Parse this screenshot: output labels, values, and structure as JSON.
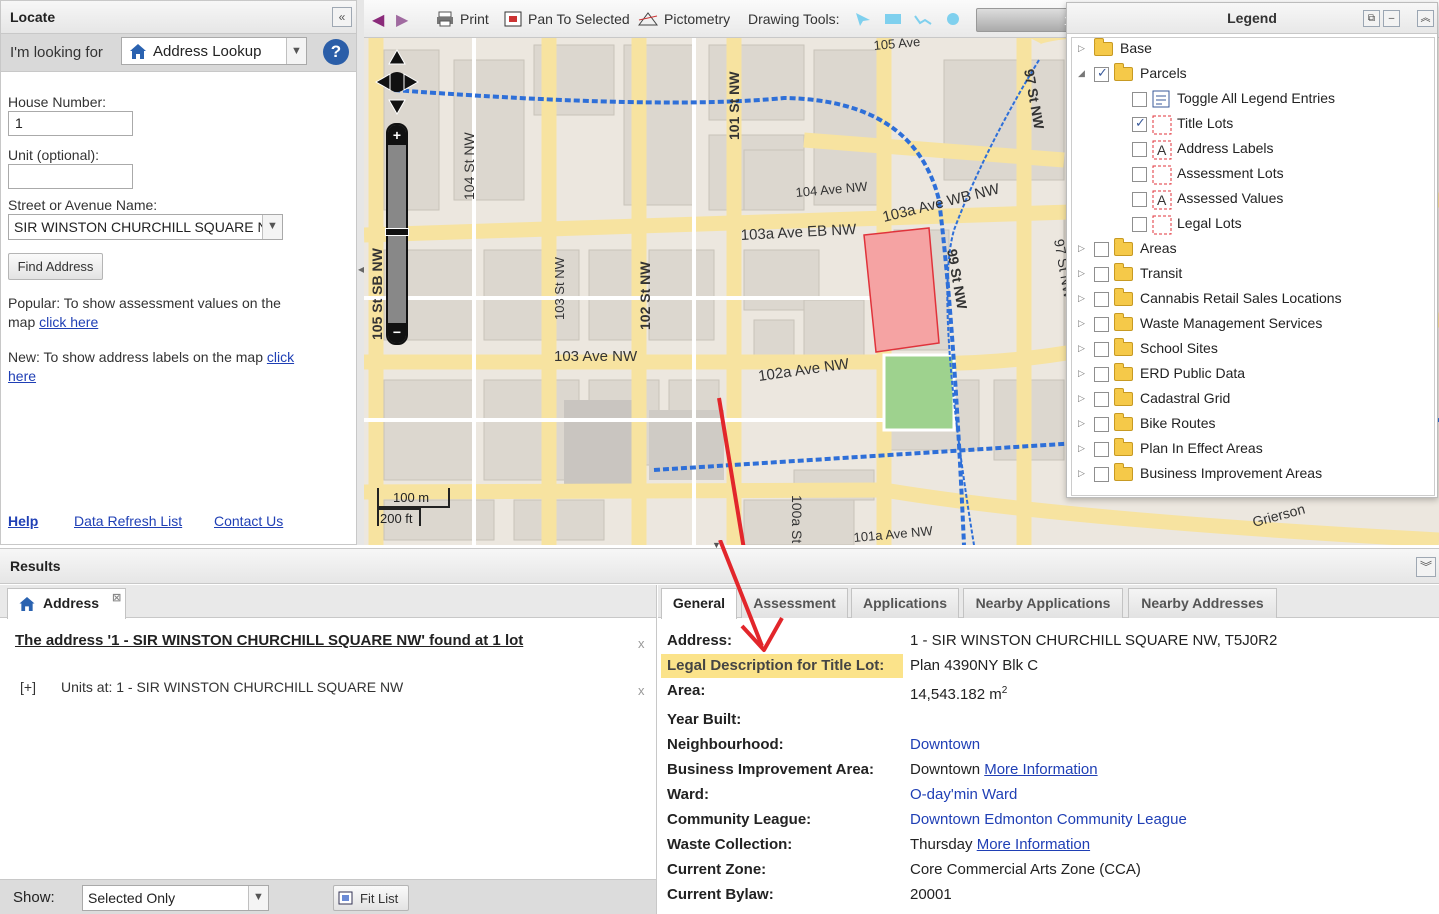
{
  "locate": {
    "title": "Locate",
    "looking_for_label": "I'm looking for",
    "looking_for_value": "Address Lookup",
    "house_number_label": "House Number:",
    "house_number_value": "1",
    "unit_label": "Unit (optional):",
    "unit_value": "",
    "street_label": "Street or Avenue Name:",
    "street_value": "SIR WINSTON CHURCHILL SQUARE N",
    "find_button": "Find Address",
    "popular_text": "Popular: To show assessment values on the map",
    "popular_link": "click here",
    "new_text": "New: To show address labels on the map",
    "new_link": "click here",
    "footer": {
      "help": "Help",
      "data_refresh": "Data Refresh List",
      "contact": "Contact Us"
    }
  },
  "toolbar": {
    "print": "Print",
    "pan_to_selected": "Pan To Selected",
    "pictometry": "Pictometry",
    "drawing_tools": "Drawing Tools:",
    "hidden_value": "1"
  },
  "map": {
    "scale_metric": "100 m",
    "scale_imperial": "200 ft",
    "streets": [
      "105 Ave",
      "97 St NW",
      "101 St NW",
      "104 St NW",
      "104 Ave NW",
      "103a Ave WB NW",
      "103a Ave EB NW",
      "105 St SB NW",
      "103 St NW",
      "102 St NW",
      "99 St NW",
      "97 St NW",
      "103 Ave NW",
      "102a Ave NW",
      "100a St",
      "101a Ave NW",
      "Grierson"
    ]
  },
  "legend": {
    "title": "Legend",
    "items": [
      {
        "label": "Base",
        "kind": "folder",
        "expanded": false,
        "checked": null
      },
      {
        "label": "Parcels",
        "kind": "folder",
        "expanded": true,
        "checked": true
      },
      {
        "label": "Toggle All Legend Entries",
        "kind": "toggle",
        "checked": false
      },
      {
        "label": "Title Lots",
        "kind": "layer",
        "checked": true
      },
      {
        "label": "Address Labels",
        "kind": "layer",
        "checked": false
      },
      {
        "label": "Assessment Lots",
        "kind": "layer",
        "checked": false
      },
      {
        "label": "Assessed Values",
        "kind": "layer",
        "checked": false
      },
      {
        "label": "Legal Lots",
        "kind": "layer",
        "checked": false
      },
      {
        "label": "Areas",
        "kind": "folder",
        "checked": false
      },
      {
        "label": "Transit",
        "kind": "folder",
        "checked": false
      },
      {
        "label": "Cannabis Retail Sales Locations",
        "kind": "folder",
        "checked": false
      },
      {
        "label": "Waste Management Services",
        "kind": "folder",
        "checked": false
      },
      {
        "label": "School Sites",
        "kind": "folder",
        "checked": false
      },
      {
        "label": "ERD Public Data",
        "kind": "folder",
        "checked": false
      },
      {
        "label": "Cadastral Grid",
        "kind": "folder",
        "checked": false
      },
      {
        "label": "Bike Routes",
        "kind": "folder",
        "checked": false
      },
      {
        "label": "Plan In Effect Areas",
        "kind": "folder",
        "checked": false
      },
      {
        "label": "Business Improvement Areas",
        "kind": "folder",
        "checked": false
      }
    ]
  },
  "results": {
    "title": "Results",
    "left_tab": "Address",
    "found_text": "The address '1 - SIR WINSTON CHURCHILL SQUARE NW' found at 1 lot",
    "units_toggle": "[+]",
    "units_text": "Units at: 1 - SIR WINSTON CHURCHILL SQUARE NW",
    "show_label": "Show:",
    "show_value": "Selected Only",
    "fit_list": "Fit List",
    "tabs": [
      "General",
      "Assessment",
      "Applications",
      "Nearby Applications",
      "Nearby Addresses"
    ],
    "details": {
      "address_label": "Address:",
      "address_value": "1 - SIR WINSTON CHURCHILL SQUARE NW, T5J0R2",
      "legal_label": "Legal Description for Title Lot:",
      "legal_value": "Plan 4390NY Blk C",
      "area_label": "Area:",
      "area_value": "14,543.182 m",
      "area_sup": "2",
      "year_label": "Year Built:",
      "year_value": "",
      "neigh_label": "Neighbourhood:",
      "neigh_value": "Downtown",
      "bia_label": "Business Improvement Area:",
      "bia_value": "Downtown",
      "bia_link": "More Information",
      "ward_label": "Ward:",
      "ward_value": "O-day'min Ward",
      "league_label": "Community League:",
      "league_value": "Downtown Edmonton Community League",
      "waste_label": "Waste Collection:",
      "waste_value": "Thursday",
      "waste_link": "More Information",
      "zone_label": "Current Zone:",
      "zone_value": "Core Commercial Arts Zone (CCA)",
      "bylaw_label": "Current Bylaw:",
      "bylaw_value": "20001"
    }
  },
  "colors": {
    "highlight": "#fbe38a",
    "parcel_fill": "#f5a3a3",
    "parcel_stroke": "#e0333b",
    "annotation_arrow": "#e2262b",
    "rail": "#2e6fd8",
    "road": "#f8e6a0"
  }
}
